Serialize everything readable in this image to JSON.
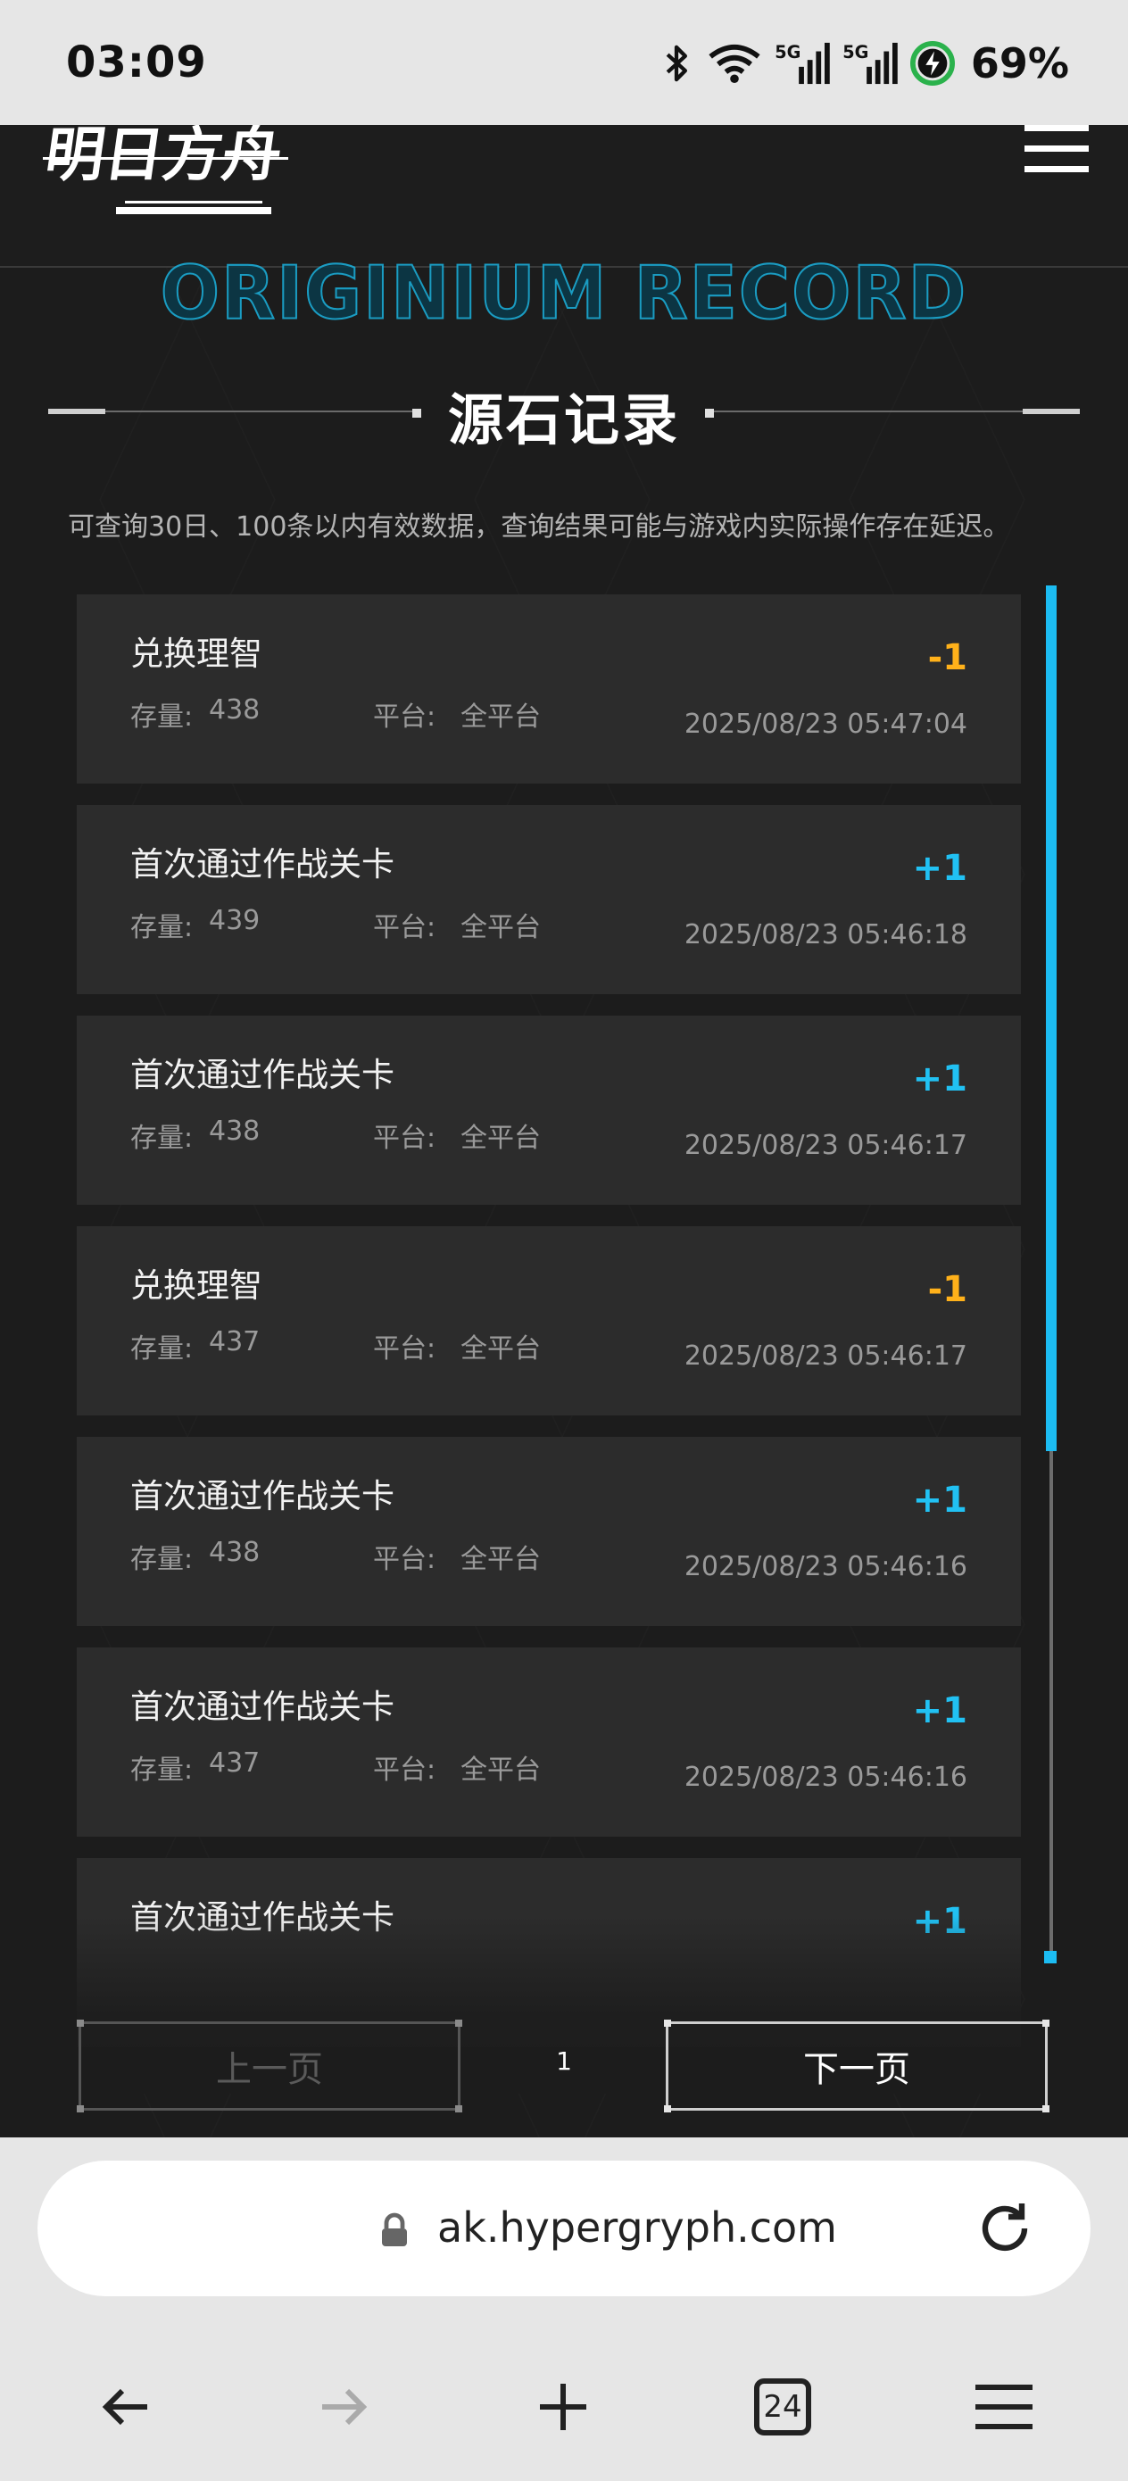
{
  "status_bar": {
    "time": "03:09",
    "battery": "69%",
    "icons": [
      "bluetooth-icon",
      "wifi-icon",
      "signal-5g-icon",
      "signal-5g-icon",
      "battery-charging-icon"
    ]
  },
  "header": {
    "logo": "明日方舟",
    "menu_icon": "hamburger-menu-icon"
  },
  "section": {
    "title_en": "ORIGINIUM RECORD",
    "title_cn": "源石记录",
    "notice": "可查询30日、100条以内有效数据，查询结果可能与游戏内实际操作存在延迟。"
  },
  "labels": {
    "stock": "存量:",
    "platform": "平台:"
  },
  "records": [
    {
      "title": "兑换理智",
      "stock": "438",
      "platform": "全平台",
      "delta": "-1",
      "time": "2025/08/23 05:47:04"
    },
    {
      "title": "首次通过作战关卡",
      "stock": "439",
      "platform": "全平台",
      "delta": "+1",
      "time": "2025/08/23 05:46:18"
    },
    {
      "title": "首次通过作战关卡",
      "stock": "438",
      "platform": "全平台",
      "delta": "+1",
      "time": "2025/08/23 05:46:17"
    },
    {
      "title": "兑换理智",
      "stock": "437",
      "platform": "全平台",
      "delta": "-1",
      "time": "2025/08/23 05:46:17"
    },
    {
      "title": "首次通过作战关卡",
      "stock": "438",
      "platform": "全平台",
      "delta": "+1",
      "time": "2025/08/23 05:46:16"
    },
    {
      "title": "首次通过作战关卡",
      "stock": "437",
      "platform": "全平台",
      "delta": "+1",
      "time": "2025/08/23 05:46:16"
    },
    {
      "title": "首次通过作战关卡",
      "stock": "",
      "platform": "",
      "delta": "+1",
      "time": ""
    }
  ],
  "colors": {
    "negative": "#ffb11a",
    "positive": "#21c1f3",
    "accent": "#1cbcf2"
  },
  "pager": {
    "prev": "上一页",
    "page": "1",
    "next": "下一页"
  },
  "browser": {
    "url": "ak.hypergryph.com",
    "tabs": "24"
  }
}
